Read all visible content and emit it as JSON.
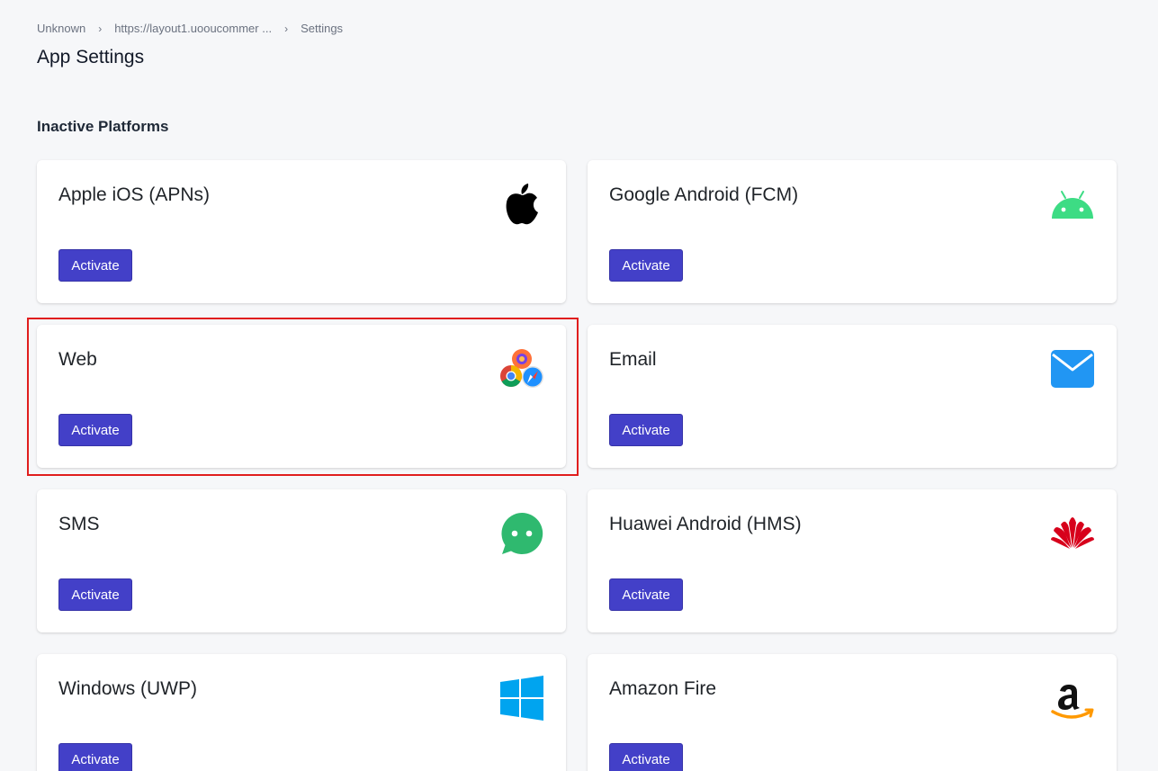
{
  "breadcrumb": {
    "items": [
      "Unknown",
      "https://layout1.uooucommer ...",
      "Settings"
    ]
  },
  "page_title": "App Settings",
  "section_title": "Inactive Platforms",
  "colors": {
    "accent": "#4340c8",
    "highlight": "#e01e1e",
    "android_green": "#3ddc84",
    "email_blue": "#2196f3",
    "sms_green": "#2fb96f",
    "huawei_red": "#d7001b",
    "windows_blue": "#00a4ef",
    "amazon_orange": "#ff9900"
  },
  "platforms": [
    {
      "title": "Apple iOS (APNs)",
      "button": "Activate",
      "icon": "apple-icon"
    },
    {
      "title": "Google Android (FCM)",
      "button": "Activate",
      "icon": "android-icon"
    },
    {
      "title": "Web",
      "button": "Activate",
      "icon": "web-browsers-icon"
    },
    {
      "title": "Email",
      "button": "Activate",
      "icon": "email-icon"
    },
    {
      "title": "SMS",
      "button": "Activate",
      "icon": "sms-icon"
    },
    {
      "title": "Huawei Android (HMS)",
      "button": "Activate",
      "icon": "huawei-icon"
    },
    {
      "title": "Windows (UWP)",
      "button": "Activate",
      "icon": "windows-icon"
    },
    {
      "title": "Amazon Fire",
      "button": "Activate",
      "icon": "amazon-icon"
    }
  ]
}
